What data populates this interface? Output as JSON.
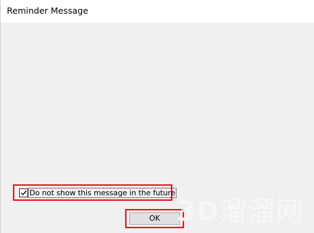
{
  "window": {
    "title": "Reminder Message"
  },
  "reminder": {
    "checkbox_label": "Do not show this message in the future",
    "checkbox_checked": true
  },
  "buttons": {
    "ok_label": "OK"
  },
  "watermark": {
    "text": "3D溜溜网"
  },
  "colors": {
    "highlight": "#e8101a",
    "background": "#f0f0f0",
    "titlebar": "#ffffff"
  }
}
